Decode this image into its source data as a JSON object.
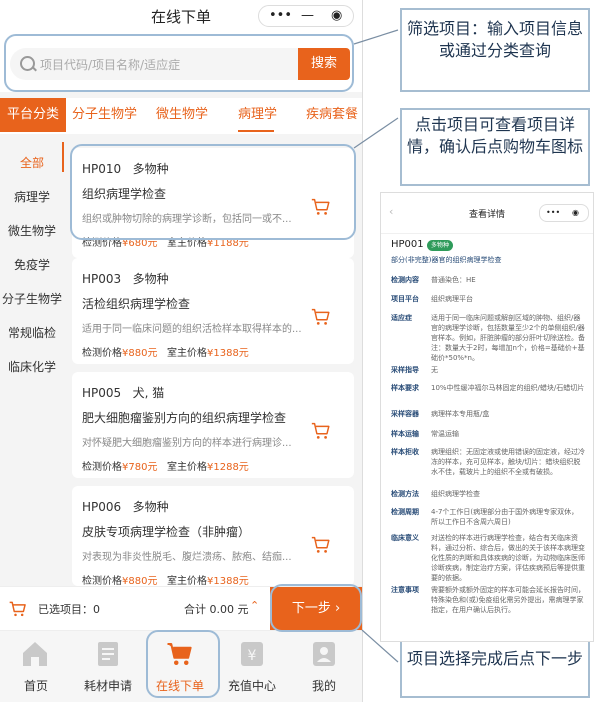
{
  "phone": {
    "title": "在线下单",
    "capsule": {
      "dots": "•••",
      "minus": "—",
      "target": "◉"
    },
    "search": {
      "placeholder": "项目代码/项目名称/适应症",
      "button": "搜索"
    },
    "tabs": [
      "平台分类",
      "分子生物学",
      "微生物学",
      "病理学",
      "疾病套餐"
    ],
    "sidebar": [
      "全部",
      "病理学",
      "微生物学",
      "免疫学",
      "分子生物学",
      "常规临检",
      "临床化学"
    ],
    "price_label": "检测价格",
    "retail_label": "室主价格",
    "cards": [
      {
        "code": "HP010",
        "species": "多物种",
        "name": "组织病理学检查",
        "desc": "组织或肿物切除的病理学诊断，包括同一或不...",
        "price": "¥680元",
        "retail": "¥1188元"
      },
      {
        "code": "HP003",
        "species": "多物种",
        "name": "活检组织病理学检查",
        "desc": "适用于同一临床问题的组织活检样本取得样本的...",
        "price": "¥880元",
        "retail": "¥1388元"
      },
      {
        "code": "HP005",
        "species": "犬, 猫",
        "name": "肥大细胞瘤鉴别方向的组织病理学检查",
        "desc": "对怀疑肥大细胞瘤鉴别方向的样本进行病理诊...",
        "price": "¥780元",
        "retail": "¥1288元"
      },
      {
        "code": "HP006",
        "species": "多物种",
        "name": "皮肤专项病理学检查（非肿瘤）",
        "desc": "对表现为非炎性脱毛、腹烂溃疡、脓疱、结痂...",
        "price": "¥880元",
        "retail": "¥1388元"
      }
    ],
    "bottom": {
      "selected": "已选项目：0",
      "total": "合计 0.00 元",
      "next": "下一步 ›"
    },
    "nav": [
      "首页",
      "耗材申请",
      "在线下单",
      "充值中心",
      "我的"
    ]
  },
  "annotations": {
    "filter": "筛选项目：输入项目信息或通过分类查询",
    "detail": "点击项目可查看项目详情，确认后点购物车图标",
    "next": "项目选择完成后点下一步"
  },
  "detail": {
    "title": "查看详情",
    "code": "HP001",
    "badge": "多物种",
    "name": "部分(非完整)器官的组织病理学检查",
    "rows": [
      {
        "label": "检测内容",
        "value": "普通染色：HE"
      },
      {
        "label": "项目平台",
        "value": "组织病理平台"
      },
      {
        "label": "适应症",
        "value": "适用于同一临床问题或解剖区域的肿物、组织/器官的病理学诊断，包括数量至少2个的单侧组织/器官样本。例如，肝脏肿瘤的部分肝叶切除送检。备注：数量大于2时，每增加n个，价格=基础价+基础价*50%*n。"
      },
      {
        "label": "采样指导",
        "value": "无"
      },
      {
        "label": "样本要求",
        "value": "10%中性缓冲福尔马林固定的组织/蜡块/石蜡切片"
      },
      {
        "label": "采样容器",
        "value": "病理样本专用瓶/盒"
      },
      {
        "label": "样本运输",
        "value": "常温运输"
      },
      {
        "label": "样本拒收",
        "value": "病理组织：无固定液或使用错误的固定液，经过冷冻的样本，充可见样本，触块/切片：蜡块组织脱水不佳，载玻片上的组织不全或有破损。"
      },
      {
        "label": "检测方法",
        "value": "组织病理学检查"
      },
      {
        "label": "检测周期",
        "value": "4-7个工作日(病理部分由于国外病理专家双休，所以工作日不含周六周日)"
      },
      {
        "label": "临床意义",
        "value": "对送检的样本进行病理学检查，结合有关临床资料，通过分析、综合后，做出的关于该样本病理变化性质的判断和具体疾病的诊断，为动物临床医师诊断疾病，制定治疗方案，评估疾病预后等提供重要的依据。"
      },
      {
        "label": "注意事项",
        "value": "需要额外或额外固定的样本可能会延长报告时间，特殊染色和(或)免疫组化需另外提出，需病理学家指定，在用户确认后执行。"
      }
    ]
  }
}
